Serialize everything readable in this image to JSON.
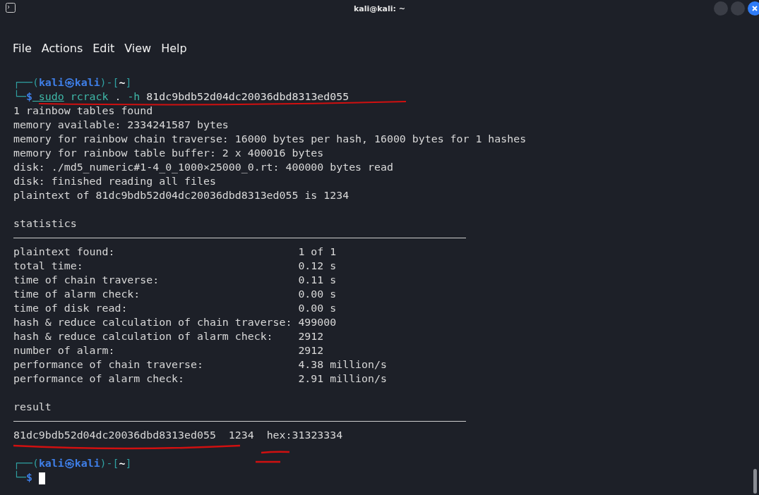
{
  "window": {
    "title": "kali@kali: ~"
  },
  "menu": [
    "File",
    "Actions",
    "Edit",
    "View",
    "Help"
  ],
  "lines": [
    {
      "kind": "prompt",
      "segments": [
        {
          "text": "┌──(",
          "color": "#2f9fa0",
          "bold": false
        },
        {
          "text": "kali㉿kali",
          "color": "#3f7fe8",
          "bold": true
        },
        {
          "text": ")-[",
          "color": "#2f9fa0",
          "bold": false
        },
        {
          "text": "~",
          "color": "#ffffff",
          "bold": true
        },
        {
          "text": "]",
          "color": "#2f9fa0",
          "bold": false
        }
      ]
    },
    {
      "kind": "command",
      "segments": [
        {
          "text": "└─",
          "color": "#2f9fa0"
        },
        {
          "text": "$",
          "color": "#3f7fe8",
          "bold": true
        },
        {
          "text": " sudo",
          "color": "#3fb8a8",
          "bold": false,
          "underline": true
        },
        {
          "text": " rcrack",
          "color": "#3fb8a8",
          "bold": false,
          "underline": false
        },
        {
          "text": " ."
        },
        {
          "text": " -h",
          "color": "#3fb8a8",
          "bold": false
        },
        {
          "text": " 81dc9bdb52d04dc20036dbd8313ed055",
          "color": "#e0e0e0",
          "bold": false
        }
      ]
    },
    {
      "kind": "text",
      "text": "1 rainbow tables found"
    },
    {
      "kind": "text",
      "text": "memory available: 2334241587 bytes"
    },
    {
      "kind": "text",
      "text": "memory for rainbow chain traverse: 16000 bytes per hash, 16000 bytes for 1 hashes"
    },
    {
      "kind": "text",
      "text": "memory for rainbow table buffer: 2 x 400016 bytes"
    },
    {
      "kind": "text",
      "text": "disk: ./md5_numeric#1-4_0_1000×25000_0.rt: 400000 bytes read"
    },
    {
      "kind": "text",
      "text": "disk: finished reading all files"
    },
    {
      "kind": "text",
      "text": "plaintext of 81dc9bdb52d04dc20036dbd8313ed055 is 1234"
    },
    {
      "kind": "blank"
    },
    {
      "kind": "text",
      "text": "statistics"
    },
    {
      "kind": "rule"
    },
    {
      "kind": "stat",
      "label": "plaintext found:",
      "value": "1 of 1"
    },
    {
      "kind": "stat",
      "label": "total time:",
      "value": "0.12 s"
    },
    {
      "kind": "stat",
      "label": "time of chain traverse:",
      "value": "0.11 s"
    },
    {
      "kind": "stat",
      "label": "time of alarm check:",
      "value": "0.00 s"
    },
    {
      "kind": "stat",
      "label": "time of disk read:",
      "value": "0.00 s"
    },
    {
      "kind": "stat",
      "label": "hash & reduce calculation of chain traverse:",
      "value": "499000"
    },
    {
      "kind": "stat",
      "label": "hash & reduce calculation of alarm check:",
      "value": "2912"
    },
    {
      "kind": "stat",
      "label": "number of alarm:",
      "value": "2912"
    },
    {
      "kind": "stat",
      "label": "performance of chain traverse:",
      "value": "4.38 million/s"
    },
    {
      "kind": "stat",
      "label": "performance of alarm check:",
      "value": "2.91 million/s"
    },
    {
      "kind": "blank"
    },
    {
      "kind": "text",
      "text": "result"
    },
    {
      "kind": "rule"
    },
    {
      "kind": "result",
      "hash": "81dc9bdb52d04dc20036dbd8313ed055",
      "plain": "1234",
      "hex": "hex:31323334"
    },
    {
      "kind": "blank"
    },
    {
      "kind": "prompt",
      "segments": [
        {
          "text": "┌──(",
          "color": "#2f9fa0",
          "bold": false
        },
        {
          "text": "kali㉿kali",
          "color": "#3f7fe8",
          "bold": true
        },
        {
          "text": ")-[",
          "color": "#2f9fa0",
          "bold": false
        },
        {
          "text": "~",
          "color": "#ffffff",
          "bold": true
        },
        {
          "text": "]",
          "color": "#2f9fa0",
          "bold": false
        }
      ]
    },
    {
      "kind": "input",
      "segments": [
        {
          "text": "└─",
          "color": "#2f9fa0"
        },
        {
          "text": "$",
          "color": "#3f7fe8",
          "bold": true
        }
      ],
      "cursor": true
    }
  ]
}
